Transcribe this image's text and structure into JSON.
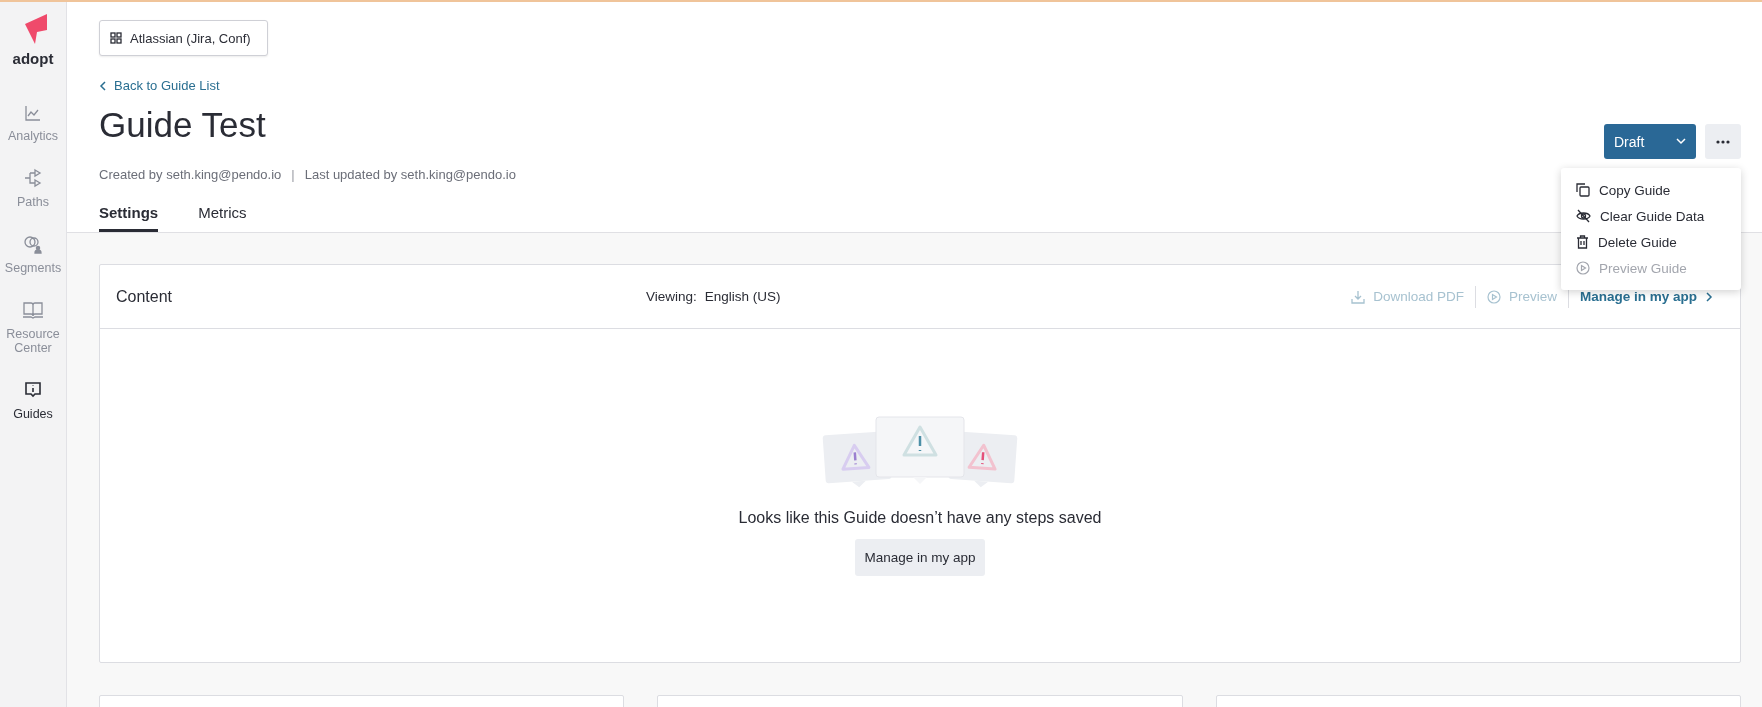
{
  "sidebar": {
    "logo": "adopt",
    "items": [
      {
        "label": "Analytics",
        "selected": false
      },
      {
        "label": "Paths",
        "selected": false
      },
      {
        "label": "Segments",
        "selected": false
      },
      {
        "label": "Resource Center",
        "selected": false
      },
      {
        "label": "Guides",
        "selected": true
      }
    ]
  },
  "app_selector": {
    "label": "Atlassian (Jira, Conf)"
  },
  "back_link": "Back to Guide List",
  "title": "Guide Test",
  "meta": {
    "created": "Created by seth.king@pendo.io",
    "separator": "|",
    "updated": "Last updated by seth.king@pendo.io"
  },
  "tabs": [
    {
      "label": "Settings",
      "selected": true
    },
    {
      "label": "Metrics",
      "selected": false
    }
  ],
  "status_button": {
    "label": "Draft"
  },
  "more_menu": {
    "items": [
      {
        "label": "Copy Guide",
        "disabled": false
      },
      {
        "label": "Clear Guide Data",
        "disabled": false
      },
      {
        "label": "Delete Guide",
        "disabled": false
      },
      {
        "label": "Preview Guide",
        "disabled": true
      }
    ]
  },
  "content": {
    "title": "Content",
    "viewing_label": "Viewing:",
    "language": "English (US)",
    "actions": [
      {
        "label": "Download PDF",
        "disabled": true
      },
      {
        "label": "Preview",
        "disabled": true
      },
      {
        "label": "Manage in my app",
        "disabled": false
      }
    ],
    "empty_message": "Looks like this Guide doesn’t have any steps saved",
    "empty_button": "Manage in my app"
  }
}
